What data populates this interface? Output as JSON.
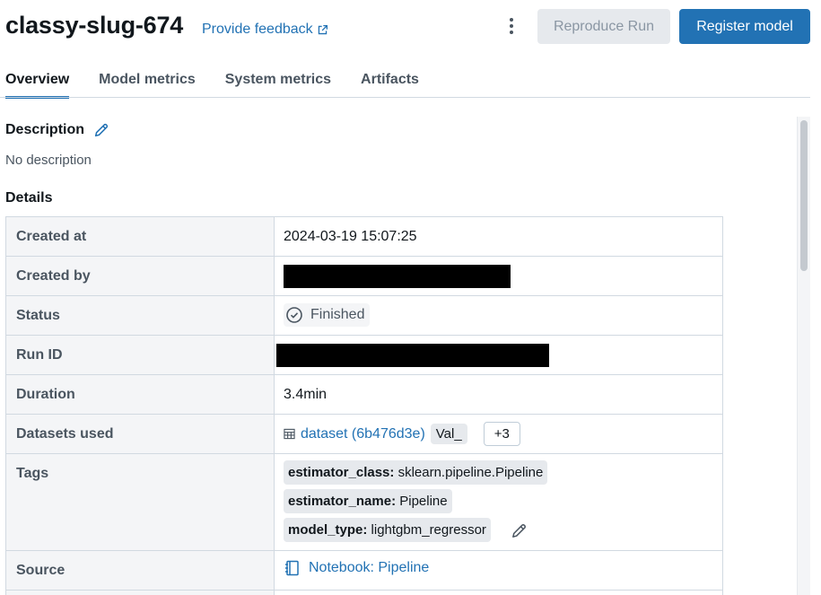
{
  "header": {
    "run_name": "classy-slug-674",
    "feedback_label": "Provide feedback",
    "reproduce_label": "Reproduce Run",
    "register_label": "Register model"
  },
  "tabs": [
    "Overview",
    "Model metrics",
    "System metrics",
    "Artifacts"
  ],
  "description": {
    "title": "Description",
    "value": "No description"
  },
  "details": {
    "title": "Details",
    "created_at_label": "Created at",
    "created_at": "2024-03-19 15:07:25",
    "created_by_label": "Created by",
    "status_label": "Status",
    "status": "Finished",
    "run_id_label": "Run ID",
    "duration_label": "Duration",
    "duration": "3.4min",
    "datasets_label": "Datasets used",
    "dataset_name": "dataset (6b476d3e)",
    "dataset_context": "Val_",
    "datasets_more": "+3",
    "tags_label": "Tags",
    "tags": [
      {
        "key": "estimator_class",
        "value": " sklearn.pipeline.Pipeline"
      },
      {
        "key": "estimator_name",
        "value": " Pipeline"
      },
      {
        "key": "model_type",
        "value": " lightgbm_regressor"
      }
    ],
    "tag_separator": ":",
    "source_label": "Source",
    "source_value": "Notebook: Pipeline"
  },
  "colors": {
    "accent": "#2272b4",
    "text": "#11171c",
    "muted": "#4a5560",
    "key_bg": "#f4f5f7",
    "border": "#d1d9e1"
  },
  "icons": [
    "external-link-icon",
    "kebab-menu-icon",
    "pencil-icon",
    "check-circle-icon",
    "table-icon",
    "notebook-icon"
  ]
}
